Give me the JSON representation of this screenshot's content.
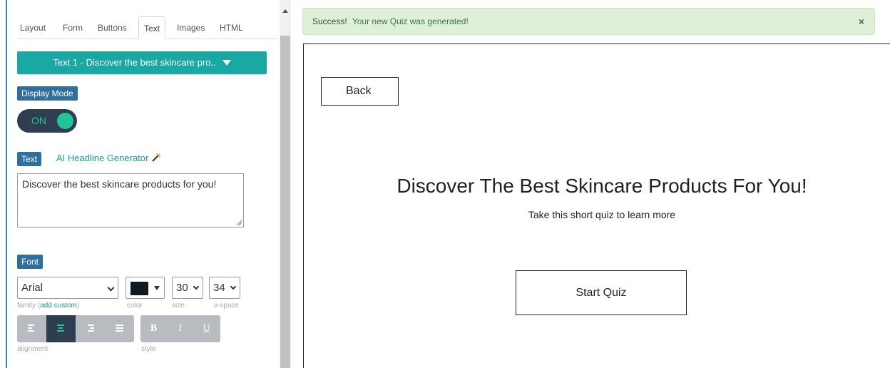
{
  "tabs": [
    {
      "label": "Layout"
    },
    {
      "label": "Form"
    },
    {
      "label": "Buttons"
    },
    {
      "label": "Text",
      "active": true
    },
    {
      "label": "Images"
    },
    {
      "label": "HTML"
    }
  ],
  "element_selector": {
    "label": "Text 1 - Discover the best skincare pro.."
  },
  "display_mode": {
    "tag": "Display Mode",
    "toggle_label": "ON",
    "on": true
  },
  "text_section": {
    "tag": "Text",
    "ai_link": "AI Headline Generator",
    "value": "Discover the best skincare products for you!"
  },
  "font": {
    "tag": "Font",
    "family": "Arial",
    "family_label": "family",
    "family_add": "add custom",
    "color_label": "color",
    "color_value": "#111a22",
    "size": "30",
    "size_label": "size",
    "vspace": "34",
    "vspace_label": "v-space",
    "alignment_label": "alignment",
    "alignment_selected": "center",
    "style_label": "style",
    "style_buttons": [
      "B",
      "I",
      "U"
    ]
  },
  "alert": {
    "strong": "Success!",
    "message": "Your new Quiz was generated!",
    "close": "×"
  },
  "preview": {
    "back_label": "Back",
    "headline": "Discover The Best Skincare Products For You!",
    "subhead": "Take this short quiz to learn more",
    "start_label": "Start Quiz"
  },
  "colors": {
    "accent_teal": "#1aa8a4",
    "tag_blue": "#2f6f9f",
    "toggle_dark": "#2e3d4f",
    "toggle_green": "#22c39b",
    "alert_bg": "#dff0d8"
  }
}
